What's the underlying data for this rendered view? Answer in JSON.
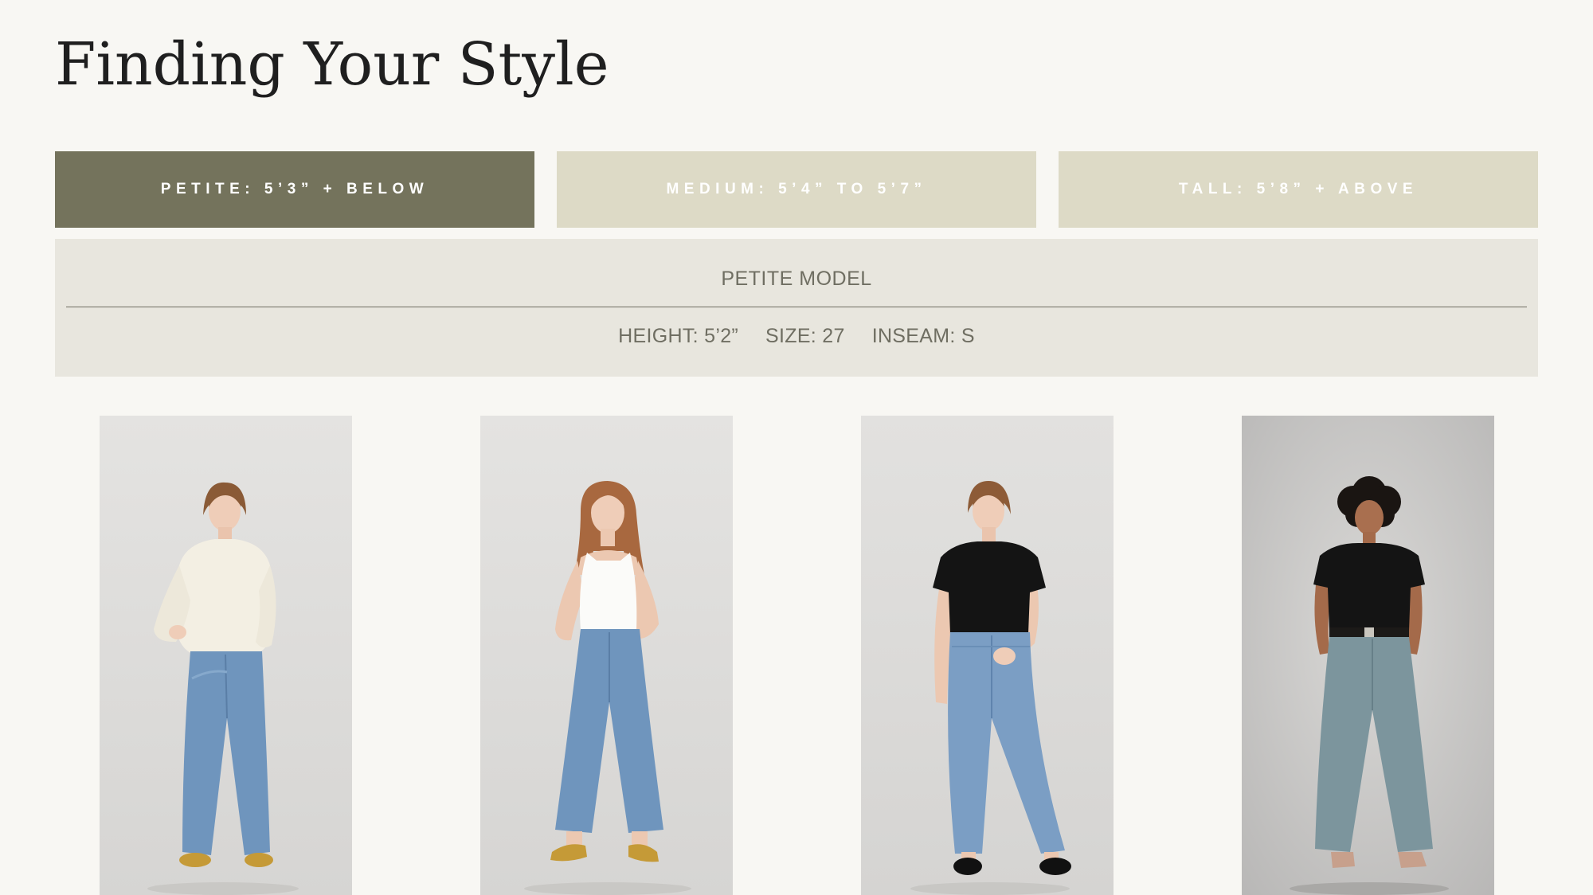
{
  "page": {
    "title": "Finding Your Style"
  },
  "tabs": [
    {
      "label": "PETITE: 5’3” + BELOW",
      "active": true
    },
    {
      "label": "MEDIUM: 5’4” TO 5’7”",
      "active": false
    },
    {
      "label": "TALL: 5’8” + ABOVE",
      "active": false
    }
  ],
  "panel": {
    "heading": "PETITE MODEL",
    "height": "HEIGHT: 5’2”",
    "size": "SIZE: 27",
    "inseam": "INSEAM: S"
  },
  "photos": [
    {
      "top": "cream-knit-sweater",
      "shoes": "mustard-flats"
    },
    {
      "top": "white-tank",
      "shoes": "mustard-mules"
    },
    {
      "top": "black-tee",
      "shoes": "black-sandals"
    },
    {
      "top": "black-tee",
      "shoes": "heeled-sandals"
    }
  ],
  "colors": {
    "background": "#f8f7f3",
    "tab_active": "#74735c",
    "tab_inactive": "#dddac6",
    "panel": "#e8e6de",
    "panel_text": "#6f6e62",
    "title": "#1f1f1f"
  }
}
